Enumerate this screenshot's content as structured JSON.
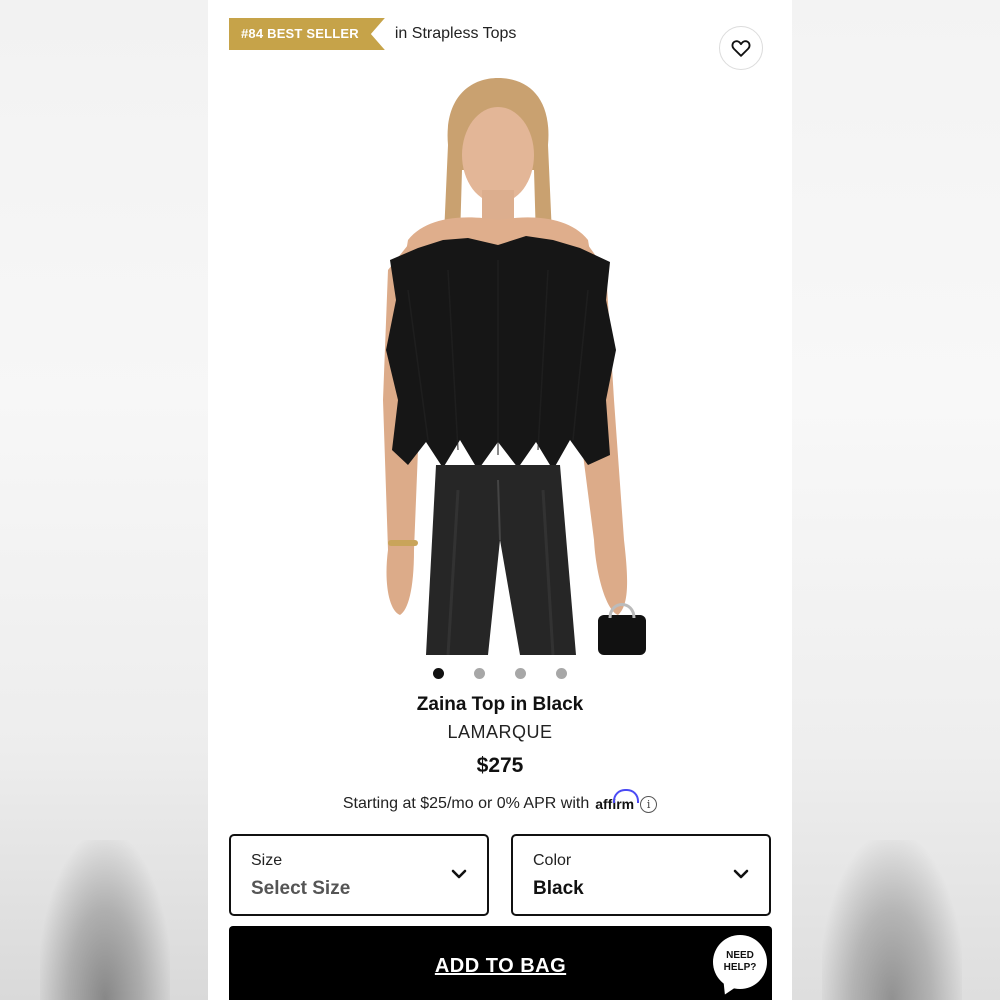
{
  "badge": {
    "rank": "#84 BEST SELLER",
    "category": "in Strapless Tops",
    "color": "#c6a349"
  },
  "favorite": {
    "icon": "heart-icon"
  },
  "product": {
    "title": "Zaina Top in Black",
    "brand": "LAMARQUE",
    "price": "$275",
    "image_count": 4,
    "active_image": 1
  },
  "financing": {
    "text": "Starting at $25/mo or 0% APR with",
    "provider": "affirm",
    "info": "i"
  },
  "size_select": {
    "label": "Size",
    "value": "Select Size"
  },
  "color_select": {
    "label": "Color",
    "value": "Black"
  },
  "cta": {
    "label": "ADD TO BAG"
  },
  "help": {
    "line1": "NEED",
    "line2": "HELP?"
  }
}
